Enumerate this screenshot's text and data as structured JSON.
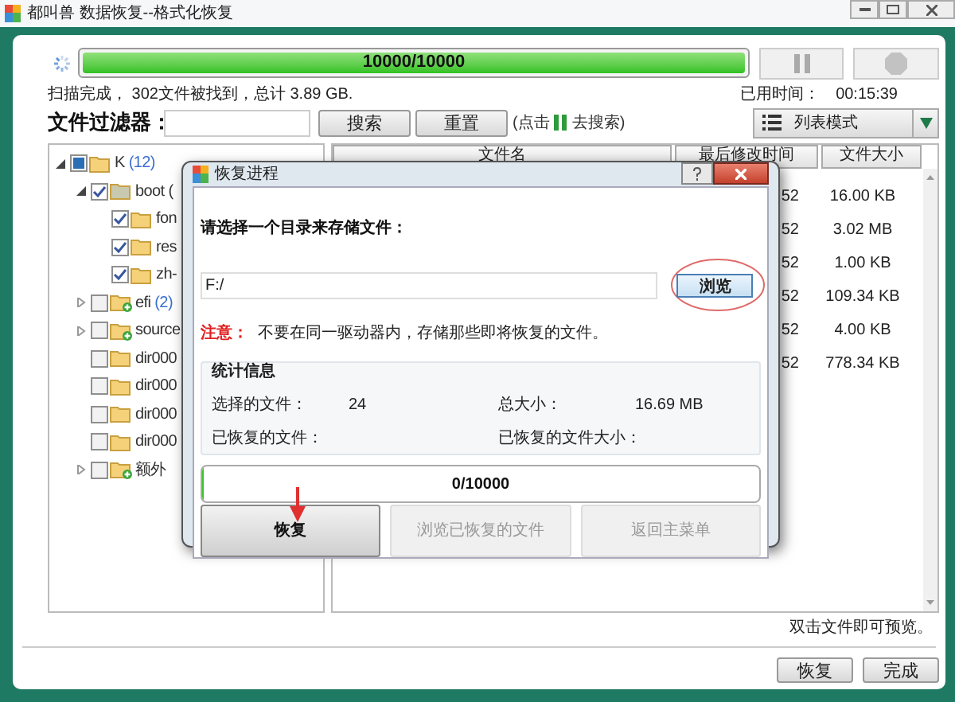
{
  "window": {
    "title": "都叫兽 数据恢复--格式化恢复"
  },
  "scan": {
    "progress": {
      "text": "10000/10000",
      "level": 1
    },
    "status": "扫描完成， 302文件被找到，总计 3.89 GB.",
    "elapsed_label": "已用时间：",
    "elapsed": "00:15:39"
  },
  "filter": {
    "label": "文件过滤器：",
    "search": "搜索",
    "reset": "重置",
    "hint_before": "(点击",
    "hint_after": "去搜索)",
    "view_mode": "列表模式"
  },
  "tree": [
    {
      "name": "K",
      "count": "(12)",
      "checked": false,
      "partial": true,
      "expanded": true,
      "kind": "folder",
      "children": [
        {
          "name": "boot (",
          "checked": true,
          "expanded": true,
          "kind": "folder-grey",
          "children": [
            {
              "name": "fon",
              "checked": true,
              "kind": "folder"
            },
            {
              "name": "res",
              "checked": true,
              "kind": "folder"
            },
            {
              "name": "zh-",
              "checked": true,
              "kind": "folder"
            }
          ]
        },
        {
          "name": "efi",
          "count": "(2)",
          "checked": false,
          "expanded": false,
          "kind": "folder-plus"
        },
        {
          "name": "source",
          "checked": false,
          "expanded": false,
          "kind": "folder-plus"
        },
        {
          "name": "dir000",
          "checked": false,
          "kind": "folder"
        },
        {
          "name": "dir000",
          "checked": false,
          "kind": "folder"
        },
        {
          "name": "dir000",
          "checked": false,
          "kind": "folder"
        },
        {
          "name": "dir000",
          "checked": false,
          "kind": "folder"
        },
        {
          "name": "额外",
          "checked": false,
          "expanded": false,
          "kind": "folder-plus"
        }
      ]
    }
  ],
  "table": {
    "columns": [
      "文件名",
      "最后修改时间",
      "文件大小"
    ],
    "rows": [
      {
        "modified": "52",
        "size": "16.00 KB"
      },
      {
        "modified": "52",
        "size": "3.02 MB"
      },
      {
        "modified": "52",
        "size": "1.00 KB"
      },
      {
        "modified": "52",
        "size": "109.34 KB"
      },
      {
        "modified": "52",
        "size": "4.00 KB"
      },
      {
        "modified": "52",
        "size": "778.34 KB"
      }
    ]
  },
  "dialog": {
    "title": "恢复进程",
    "prompt": "请选择一个目录来存储文件：",
    "path": "F:/",
    "browse": "浏览",
    "note_label": "注意：",
    "note": "不要在同一驱动器内，存储那些即将恢复的文件。",
    "stats": {
      "title": "统计信息",
      "items": [
        {
          "label": "选择的文件：",
          "value": "24"
        },
        {
          "label": "总大小：",
          "value": "16.69 MB"
        },
        {
          "label": "已恢复的文件："
        },
        {
          "label": "已恢复的文件大小："
        }
      ]
    },
    "progress": {
      "text": "0/10000",
      "level": 0
    },
    "buttons": [
      {
        "label": "恢复",
        "disabled": false
      },
      {
        "label": "浏览已恢复的文件",
        "disabled": true
      },
      {
        "label": "返回主菜单",
        "disabled": true
      }
    ]
  },
  "footer": {
    "hint": "双击文件即可预览。",
    "buttons": [
      "恢复",
      "完成"
    ]
  }
}
